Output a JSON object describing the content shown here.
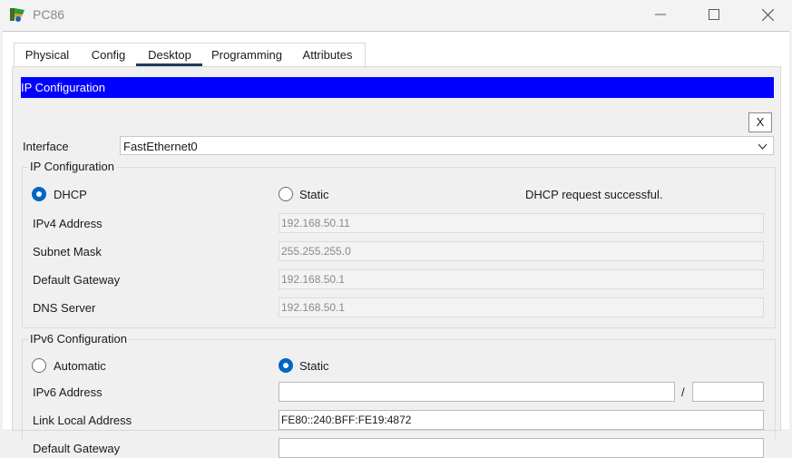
{
  "window": {
    "title": "PC86",
    "icons": {
      "app": "packet-tracer-pc-icon",
      "minimize": "minimize-icon",
      "maximize": "maximize-icon",
      "close": "close-icon"
    }
  },
  "tabs": [
    {
      "label": "Physical"
    },
    {
      "label": "Config"
    },
    {
      "label": "Desktop"
    },
    {
      "label": "Programming"
    },
    {
      "label": "Attributes"
    }
  ],
  "active_tab": "Desktop",
  "ipconfig": {
    "title": "IP Configuration",
    "close_label": "X",
    "title_bar_color": "#0000ff",
    "interface_label": "Interface",
    "interface_value": "FastEthernet0",
    "ipv4": {
      "group_title": "IP Configuration",
      "dhcp_label": "DHCP",
      "static_label": "Static",
      "selected_mode": "DHCP",
      "status": "DHCP request successful.",
      "ipv4_address_label": "IPv4 Address",
      "ipv4_address": "192.168.50.11",
      "subnet_mask_label": "Subnet Mask",
      "subnet_mask": "255.255.255.0",
      "default_gateway_label": "Default Gateway",
      "default_gateway": "192.168.50.1",
      "dns_server_label": "DNS Server",
      "dns_server": "192.168.50.1"
    },
    "ipv6": {
      "group_title": "IPv6 Configuration",
      "automatic_label": "Automatic",
      "static_label": "Static",
      "selected_mode": "Static",
      "ipv6_address_label": "IPv6 Address",
      "ipv6_address": "",
      "prefix_separator": "/",
      "prefix_length": "",
      "link_local_label": "Link Local Address",
      "link_local_address": "FE80::240:BFF:FE19:4872",
      "default_gateway_label": "Default Gateway",
      "default_gateway": ""
    }
  },
  "colors": {
    "radio_selected": "#0067c0",
    "tab_underline": "#1f3b5a"
  }
}
